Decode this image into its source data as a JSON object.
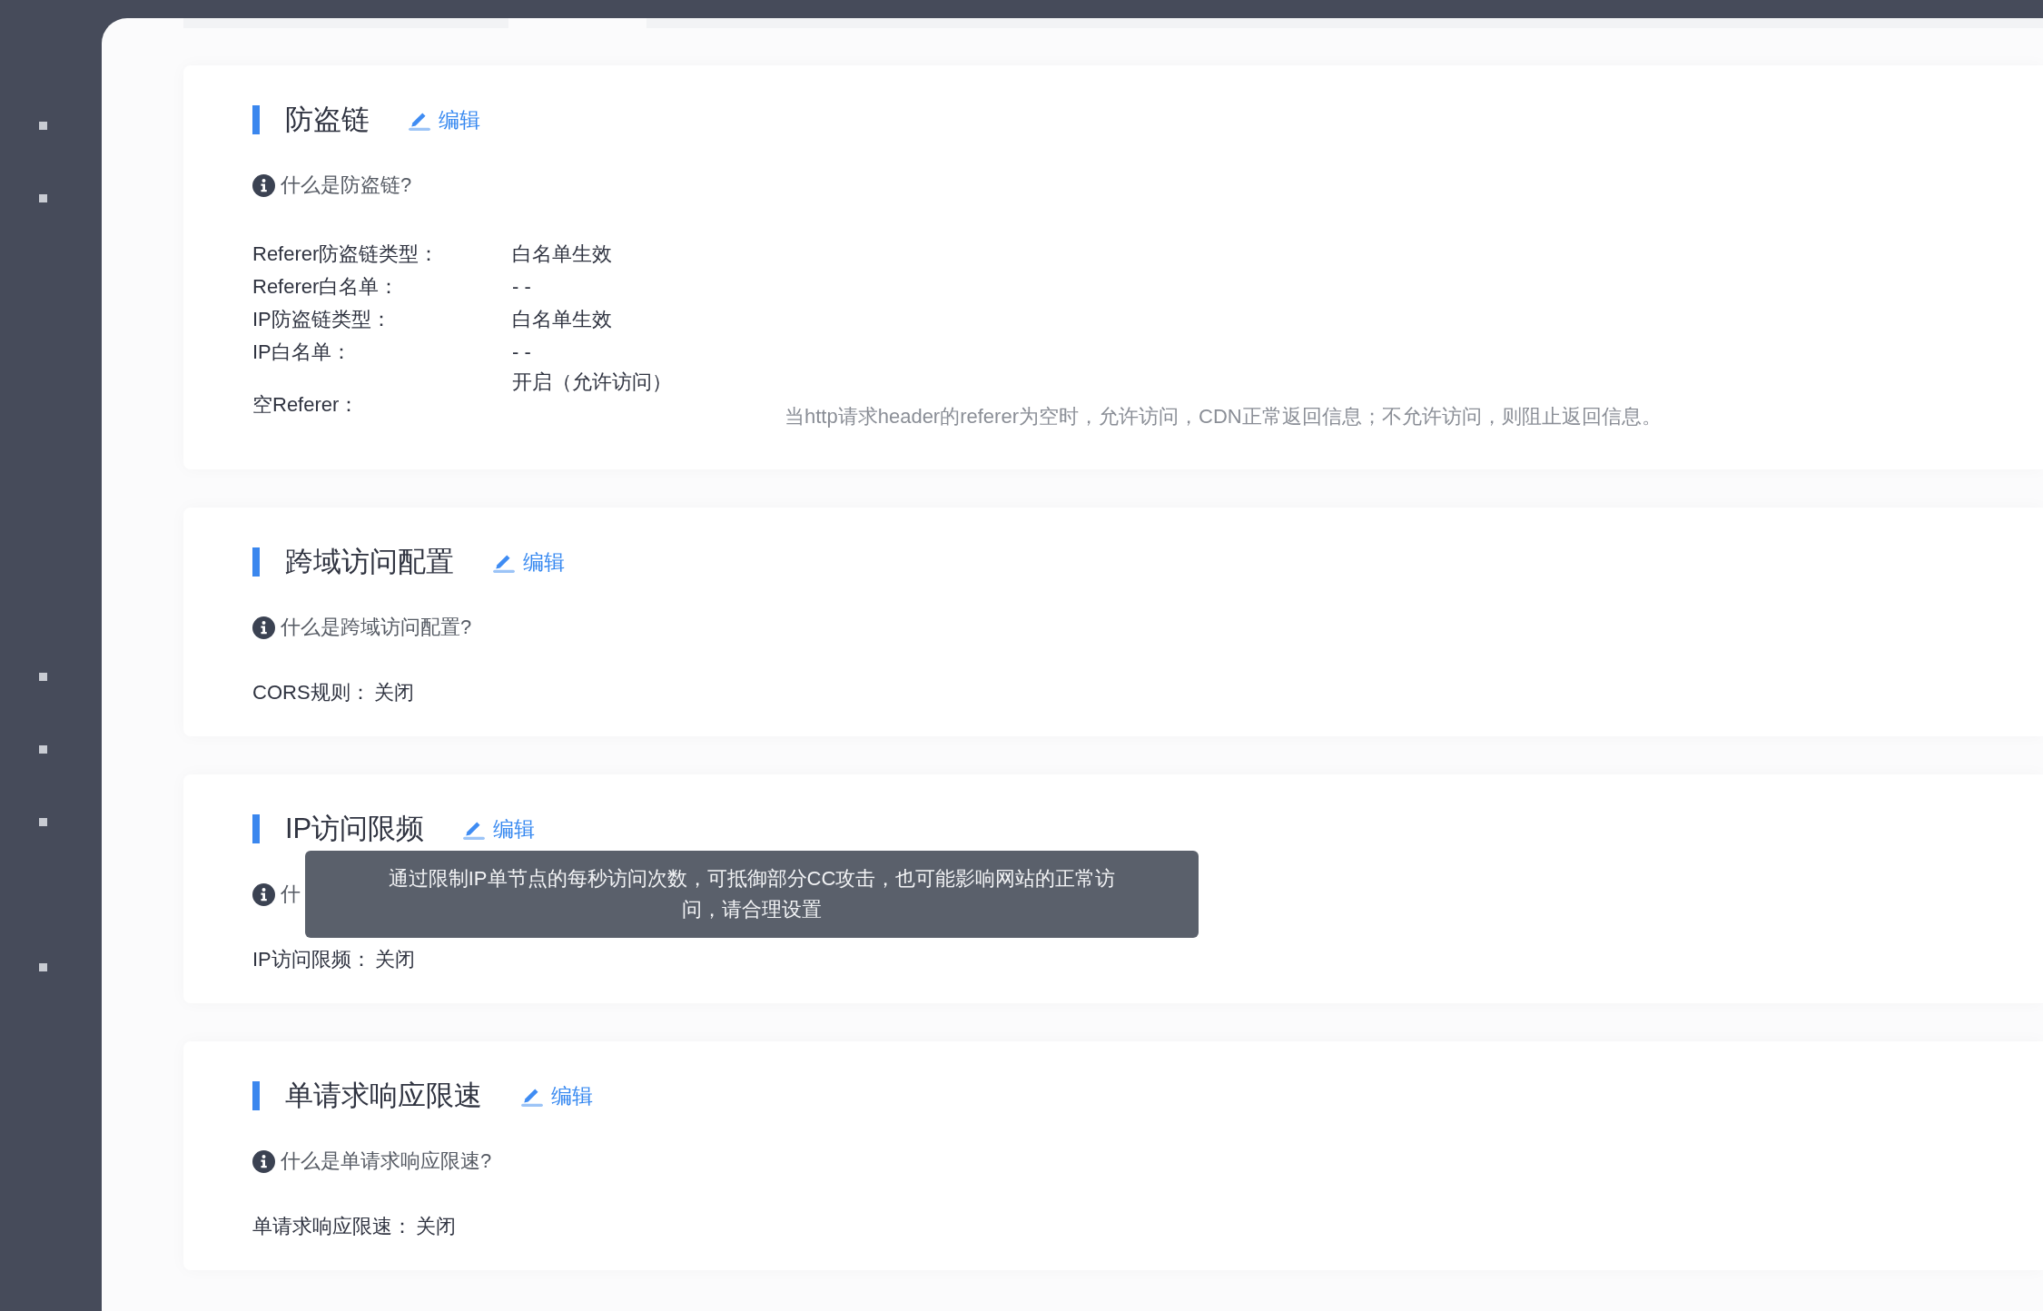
{
  "sections": [
    {
      "title": "防盗链",
      "edit": "编辑",
      "help": "什么是防盗链?",
      "kind": "table",
      "fields": [
        {
          "label": "Referer防盗链类型：",
          "value": "白名单生效"
        },
        {
          "label": "Referer白名单：",
          "value": "- -"
        },
        {
          "label": "IP防盗链类型：",
          "value": "白名单生效"
        },
        {
          "label": "IP白名单：",
          "value": "- -"
        },
        {
          "label": "空Referer：",
          "value": "开启（允许访问）",
          "note": "当http请求header的referer为空时，允许访问，CDN正常返回信息；不允许访问，则阻止返回信息。"
        }
      ]
    },
    {
      "title": "跨域访问配置",
      "edit": "编辑",
      "help": "什么是跨域访问配置?",
      "kind": "inline",
      "fields": [
        {
          "label": "CORS规则：",
          "value": "关闭"
        }
      ]
    },
    {
      "title": "IP访问限频",
      "edit": "编辑",
      "help": "什",
      "kind": "inline",
      "fields": [
        {
          "label": "IP访问限频：",
          "value": "关闭"
        }
      ],
      "tooltip": "通过限制IP单节点的每秒访问次数，可抵御部分CC攻击，也可能影响网站的正常访问，请合理设置"
    },
    {
      "title": "单请求响应限速",
      "edit": "编辑",
      "help": "什么是单请求响应限速?",
      "kind": "inline",
      "fields": [
        {
          "label": "单请求响应限速：",
          "value": "关闭"
        }
      ]
    }
  ]
}
